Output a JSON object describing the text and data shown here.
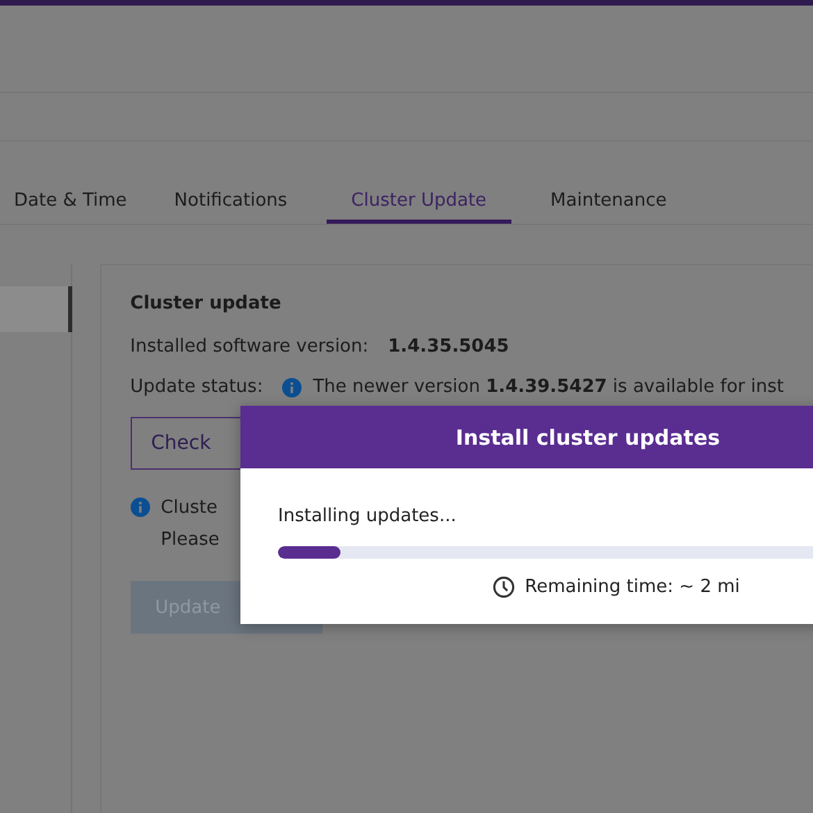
{
  "tabs": [
    {
      "label": "Date & Time",
      "selected": false
    },
    {
      "label": "Notifications",
      "selected": false
    },
    {
      "label": "Cluster Update",
      "selected": true
    },
    {
      "label": "Maintenance",
      "selected": false
    }
  ],
  "sidebar": {
    "items": [
      {
        "selected": true
      }
    ]
  },
  "panel": {
    "title": "Cluster update",
    "installed_label": "Installed software version:",
    "installed_value": "1.4.35.5045",
    "status_label": "Update status:",
    "status_text": "The newer version **1.4.39.5427** is available for inst",
    "check_button": "Check",
    "notice_lines": [
      "Cluste",
      "Please"
    ],
    "update_button": {
      "label": "Update",
      "disabled": true
    }
  },
  "dialog": {
    "title": "Install cluster updates",
    "message": "Installing updates...",
    "level": 0.1,
    "remaining": "Remaining time: ~ 2 mi"
  }
}
